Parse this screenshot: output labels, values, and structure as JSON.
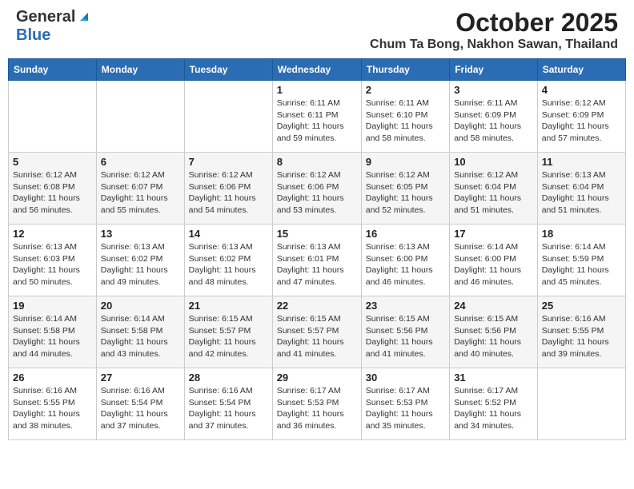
{
  "header": {
    "logo_general": "General",
    "logo_blue": "Blue",
    "month": "October 2025",
    "location": "Chum Ta Bong, Nakhon Sawan, Thailand"
  },
  "weekdays": [
    "Sunday",
    "Monday",
    "Tuesday",
    "Wednesday",
    "Thursday",
    "Friday",
    "Saturday"
  ],
  "weeks": [
    [
      {
        "day": "",
        "sunrise": "",
        "sunset": "",
        "daylight": ""
      },
      {
        "day": "",
        "sunrise": "",
        "sunset": "",
        "daylight": ""
      },
      {
        "day": "",
        "sunrise": "",
        "sunset": "",
        "daylight": ""
      },
      {
        "day": "1",
        "sunrise": "Sunrise: 6:11 AM",
        "sunset": "Sunset: 6:11 PM",
        "daylight": "Daylight: 11 hours and 59 minutes."
      },
      {
        "day": "2",
        "sunrise": "Sunrise: 6:11 AM",
        "sunset": "Sunset: 6:10 PM",
        "daylight": "Daylight: 11 hours and 58 minutes."
      },
      {
        "day": "3",
        "sunrise": "Sunrise: 6:11 AM",
        "sunset": "Sunset: 6:09 PM",
        "daylight": "Daylight: 11 hours and 58 minutes."
      },
      {
        "day": "4",
        "sunrise": "Sunrise: 6:12 AM",
        "sunset": "Sunset: 6:09 PM",
        "daylight": "Daylight: 11 hours and 57 minutes."
      }
    ],
    [
      {
        "day": "5",
        "sunrise": "Sunrise: 6:12 AM",
        "sunset": "Sunset: 6:08 PM",
        "daylight": "Daylight: 11 hours and 56 minutes."
      },
      {
        "day": "6",
        "sunrise": "Sunrise: 6:12 AM",
        "sunset": "Sunset: 6:07 PM",
        "daylight": "Daylight: 11 hours and 55 minutes."
      },
      {
        "day": "7",
        "sunrise": "Sunrise: 6:12 AM",
        "sunset": "Sunset: 6:06 PM",
        "daylight": "Daylight: 11 hours and 54 minutes."
      },
      {
        "day": "8",
        "sunrise": "Sunrise: 6:12 AM",
        "sunset": "Sunset: 6:06 PM",
        "daylight": "Daylight: 11 hours and 53 minutes."
      },
      {
        "day": "9",
        "sunrise": "Sunrise: 6:12 AM",
        "sunset": "Sunset: 6:05 PM",
        "daylight": "Daylight: 11 hours and 52 minutes."
      },
      {
        "day": "10",
        "sunrise": "Sunrise: 6:12 AM",
        "sunset": "Sunset: 6:04 PM",
        "daylight": "Daylight: 11 hours and 51 minutes."
      },
      {
        "day": "11",
        "sunrise": "Sunrise: 6:13 AM",
        "sunset": "Sunset: 6:04 PM",
        "daylight": "Daylight: 11 hours and 51 minutes."
      }
    ],
    [
      {
        "day": "12",
        "sunrise": "Sunrise: 6:13 AM",
        "sunset": "Sunset: 6:03 PM",
        "daylight": "Daylight: 11 hours and 50 minutes."
      },
      {
        "day": "13",
        "sunrise": "Sunrise: 6:13 AM",
        "sunset": "Sunset: 6:02 PM",
        "daylight": "Daylight: 11 hours and 49 minutes."
      },
      {
        "day": "14",
        "sunrise": "Sunrise: 6:13 AM",
        "sunset": "Sunset: 6:02 PM",
        "daylight": "Daylight: 11 hours and 48 minutes."
      },
      {
        "day": "15",
        "sunrise": "Sunrise: 6:13 AM",
        "sunset": "Sunset: 6:01 PM",
        "daylight": "Daylight: 11 hours and 47 minutes."
      },
      {
        "day": "16",
        "sunrise": "Sunrise: 6:13 AM",
        "sunset": "Sunset: 6:00 PM",
        "daylight": "Daylight: 11 hours and 46 minutes."
      },
      {
        "day": "17",
        "sunrise": "Sunrise: 6:14 AM",
        "sunset": "Sunset: 6:00 PM",
        "daylight": "Daylight: 11 hours and 46 minutes."
      },
      {
        "day": "18",
        "sunrise": "Sunrise: 6:14 AM",
        "sunset": "Sunset: 5:59 PM",
        "daylight": "Daylight: 11 hours and 45 minutes."
      }
    ],
    [
      {
        "day": "19",
        "sunrise": "Sunrise: 6:14 AM",
        "sunset": "Sunset: 5:58 PM",
        "daylight": "Daylight: 11 hours and 44 minutes."
      },
      {
        "day": "20",
        "sunrise": "Sunrise: 6:14 AM",
        "sunset": "Sunset: 5:58 PM",
        "daylight": "Daylight: 11 hours and 43 minutes."
      },
      {
        "day": "21",
        "sunrise": "Sunrise: 6:15 AM",
        "sunset": "Sunset: 5:57 PM",
        "daylight": "Daylight: 11 hours and 42 minutes."
      },
      {
        "day": "22",
        "sunrise": "Sunrise: 6:15 AM",
        "sunset": "Sunset: 5:57 PM",
        "daylight": "Daylight: 11 hours and 41 minutes."
      },
      {
        "day": "23",
        "sunrise": "Sunrise: 6:15 AM",
        "sunset": "Sunset: 5:56 PM",
        "daylight": "Daylight: 11 hours and 41 minutes."
      },
      {
        "day": "24",
        "sunrise": "Sunrise: 6:15 AM",
        "sunset": "Sunset: 5:56 PM",
        "daylight": "Daylight: 11 hours and 40 minutes."
      },
      {
        "day": "25",
        "sunrise": "Sunrise: 6:16 AM",
        "sunset": "Sunset: 5:55 PM",
        "daylight": "Daylight: 11 hours and 39 minutes."
      }
    ],
    [
      {
        "day": "26",
        "sunrise": "Sunrise: 6:16 AM",
        "sunset": "Sunset: 5:55 PM",
        "daylight": "Daylight: 11 hours and 38 minutes."
      },
      {
        "day": "27",
        "sunrise": "Sunrise: 6:16 AM",
        "sunset": "Sunset: 5:54 PM",
        "daylight": "Daylight: 11 hours and 37 minutes."
      },
      {
        "day": "28",
        "sunrise": "Sunrise: 6:16 AM",
        "sunset": "Sunset: 5:54 PM",
        "daylight": "Daylight: 11 hours and 37 minutes."
      },
      {
        "day": "29",
        "sunrise": "Sunrise: 6:17 AM",
        "sunset": "Sunset: 5:53 PM",
        "daylight": "Daylight: 11 hours and 36 minutes."
      },
      {
        "day": "30",
        "sunrise": "Sunrise: 6:17 AM",
        "sunset": "Sunset: 5:53 PM",
        "daylight": "Daylight: 11 hours and 35 minutes."
      },
      {
        "day": "31",
        "sunrise": "Sunrise: 6:17 AM",
        "sunset": "Sunset: 5:52 PM",
        "daylight": "Daylight: 11 hours and 34 minutes."
      },
      {
        "day": "",
        "sunrise": "",
        "sunset": "",
        "daylight": ""
      }
    ]
  ]
}
